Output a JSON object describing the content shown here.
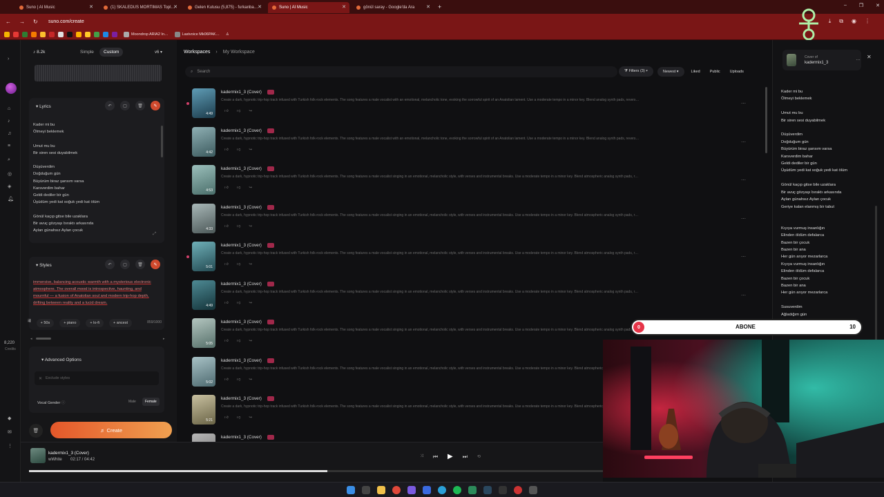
{
  "browser": {
    "tabs": [
      {
        "title": "Suno | AI Music",
        "active": false
      },
      {
        "title": "(1) SKALEDUS MORTIMAS Topl…",
        "active": false
      },
      {
        "title": "Gelen Kutusu (5,875) - furkanba…",
        "active": false
      },
      {
        "title": "Suno | AI Music",
        "active": true
      },
      {
        "title": "gönül saray - Google'da Ara",
        "active": false
      }
    ],
    "url": "suno.com/create",
    "bookmarks": [
      "Moondrop ARIA2 In…",
      "Lastvoice Mk06PAK…"
    ],
    "accent": "#7a1616"
  },
  "create": {
    "song_count": "8.2k",
    "mode_simple": "Simple",
    "mode_custom": "Custom",
    "version": "v6",
    "lyrics_title": "Lyrics",
    "lyrics_text": "Kader mi bu\nÖlmeyi beklemek\n\nUmut mu bu\nBir siren sesi duyabilmek\n\nDüşüverdim\nDoğduğum gün\nBüyürüm biraz şansım varsa\nKarsverdim bahar\nGeldi dediler bir gün\nÜşüdüm yedi kat soğuk yedi kat ölüm\n\nGönül kaçıp gitse bile uzaklara\nBir avuç gözyaşı bıraktı arkasında\nAylan günahsız Aylan çocuk",
    "styles_title": "Styles",
    "styles_text": "immersive, balancing acoustic warmth with a mysterious electronic atmosphere. The overall mood is introspective, haunting, and mournful — a fusion of Anatolian soul and modern trip-hop depth, drifting between reality and a lucid dream.",
    "styles_count": "859/1000",
    "tags": [
      "+ 50s",
      "+ piano",
      "+ lo-fi",
      "+ ancest"
    ],
    "advanced_title": "Advanced Options",
    "exclude_placeholder": "Exclude styles",
    "vocal_gender_label": "Vocal Gender",
    "vocal_male": "Male",
    "vocal_female": "Female",
    "create_label": "Create"
  },
  "rail": {
    "credits": "8,220",
    "credits_label": "Credits"
  },
  "workspace": {
    "breadcrumb_root": "Workspaces",
    "breadcrumb_current": "My Workspace",
    "search_placeholder": "Search",
    "filters_label": "Filters (3)",
    "sort_label": "Newest",
    "liked": "Liked",
    "public": "Public",
    "uploads": "Uploads",
    "songs": [
      {
        "title": "kadermix1_3 (Cover)",
        "duration": "4:49",
        "dot": true,
        "desc": "Create a dark, hypnotic trip-hop track infused with Turkish folk-rock elements. The song features a male vocalist with an emotional, melancholic tone, evoking the sorrowful spirit of an Anatolian lament. Use a moderate tempo in a minor key. Blend analog synth pads, revers…",
        "c1": "#5f9cb5",
        "c2": "#1c3c4c"
      },
      {
        "title": "kadermix1_3 (Cover)",
        "duration": "4:42",
        "dot": false,
        "desc": "Create a dark, hypnotic trip-hop track infused with Turkish folk-rock elements. The song features a male vocalist with an emotional, melancholic tone, evoking the sorrowful spirit of an Anatolian lament. Use a moderate tempo in a minor key. Blend analog synth pads, revers…",
        "c1": "#8fb0b4",
        "c2": "#3c5a5e"
      },
      {
        "title": "kadermix1_3 (Cover)",
        "duration": "4:53",
        "dot": false,
        "desc": "Create a dark, hypnotic trip-hop track infused with Turkish folk-rock elements. The song features a male vocalist singing in an emotional, melancholic style, with verses and instrumental breaks. Use a moderate tempo in a minor key. Blend atmospheric analog synth pads, r…",
        "c1": "#9cc0bc",
        "c2": "#4a6e6a"
      },
      {
        "title": "kadermix1_3 (Cover)",
        "duration": "4:33",
        "dot": false,
        "desc": "Create a dark, hypnotic trip-hop track infused with Turkish folk-rock elements. The song features a male vocalist singing in an emotional, melancholic style, with verses and instrumental breaks. Use a moderate tempo in a minor key. Blend atmospheric analog synth pads, r…",
        "c1": "#a9b8b8",
        "c2": "#4c5858"
      },
      {
        "title": "kadermix1_3 (Cover)",
        "duration": "5:01",
        "dot": true,
        "desc": "Create a dark, hypnotic trip-hop track infused with Turkish folk-rock elements. The song features a male vocalist singing in an emotional, melancholic style, with verses and instrumental breaks. Use a moderate tempo in a minor key. Blend atmospheric analog synth pads, r…",
        "c1": "#6fb0b8",
        "c2": "#234a52"
      },
      {
        "title": "kadermix1_3 (Cover)",
        "duration": "4:49",
        "dot": false,
        "desc": "Create a dark, hypnotic trip-hop track infused with Turkish folk-rock elements. The song features a male vocalist singing in an emotional, melancholic style, with verses and instrumental breaks. Use a moderate tempo in a minor key. Blend atmospheric analog synth pads, r…",
        "c1": "#4e8a94",
        "c2": "#14343a"
      },
      {
        "title": "kadermix1_3 (Cover)",
        "duration": "5:05",
        "dot": false,
        "desc": "Create a dark, hypnotic trip-hop track infused with Turkish folk-rock elements. The song features a male vocalist singing in an emotional, melancholic style, with verses and instrumental breaks. Use a moderate tempo in a minor key. Blend atmospheric analog synth pads, r…",
        "c1": "#b4c6c0",
        "c2": "#56706a"
      },
      {
        "title": "kadermix1_3 (Cover)",
        "duration": "5:02",
        "dot": false,
        "desc": "Create a dark, hypnotic trip-hop track infused with Turkish folk-rock elements. The song features a male vocalist singing in an emotional, melancholic style, with verses and instrumental breaks. Use a moderate tempo in a minor key. Blend atmospheric analog synth pads, r…",
        "c1": "#a8c2c6",
        "c2": "#4e6a70"
      },
      {
        "title": "kadermix1_3 (Cover)",
        "duration": "5:21",
        "dot": false,
        "desc": "Create a dark, hypnotic trip-hop track infused with Turkish folk-rock elements. The song features a male vocalist singing in an emotional, melancholic style, with verses and instrumental breaks. Use a moderate tempo in a minor key. Blend atmospheric analog synth pads, r…",
        "c1": "#c8c0a0",
        "c2": "#6a6446"
      },
      {
        "title": "kadermix1_3 (Cover)",
        "duration": "",
        "dot": false,
        "desc": "",
        "c1": "#b8b8b8",
        "c2": "#6a6a6a"
      }
    ]
  },
  "lyrics_panel": {
    "cover_label": "Cover of",
    "name": "kadermix1_3",
    "text": "Kader mi bu\nÖlmeyi beklemek\n\nUmut mu bu\nBir siren sesi duyabilmek\n\nDüşüverdim\nDoğduğum gün\nBüyürüm biraz şansım varsa\nKarsverdim bahar\nGeldi dediler bir gün\nÜşüdüm yedi kat soğuk yedi kat ölüm\n\nGönül kaçıp gitse bile uzaklara\nBir avuç gözyaşı bıraktı arkasında\nAylan günahsız Aylan çocuk\nGeriye kalan elanmış bir tabut\n\n\nKıyıya vurmuş insanlığın\nElinden öldüm defalarca\nBazen bir çocuk\nBazen bir ana\nHer gün arıyor mezarlarca\nKıyıya vurmuş insanlığın\nElinden öldüm defalarca\nBazen bir çocuk\nBazen bir ana\nHer gün arıyor mezarlarca\n\nSusuverdim\nAğladığım gün\nBüyümek bir şans değilmiş oysa\nKarsverdim bahar"
  },
  "subscribe_overlay": {
    "left": "0",
    "label": "ABONE",
    "right": "10"
  },
  "player": {
    "title": "kadermix1_3 (Cover)",
    "artist": "wWhite",
    "time": "02:17  /  04:42",
    "progress": 0.52
  }
}
